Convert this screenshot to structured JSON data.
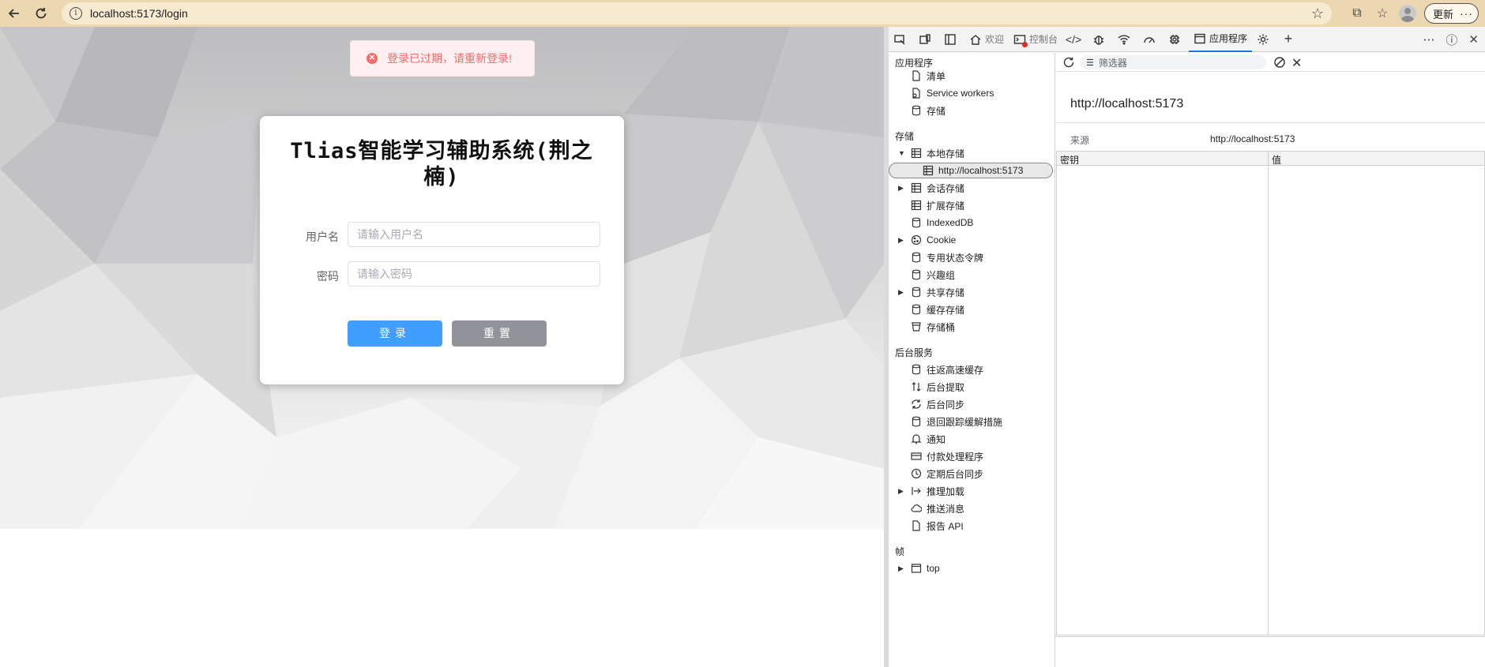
{
  "browser": {
    "url": "localhost:5173/login",
    "update_label": "更新",
    "more_label": "···"
  },
  "toast": {
    "message": "登录已过期，请重新登录!",
    "type": "error"
  },
  "login": {
    "title": "Tlias智能学习辅助系统(荆之楠)",
    "username_label": "用户名",
    "username_placeholder": "请输入用户名",
    "password_label": "密码",
    "password_placeholder": "请输入密码",
    "login_button": "登录",
    "reset_button": "重置"
  },
  "devtools": {
    "tabs": [
      {
        "label": "欢迎",
        "icon": "home-icon"
      },
      {
        "label": "控制台",
        "icon": "console-icon"
      },
      {
        "label": "应用程序",
        "icon": "application-icon",
        "active": true
      }
    ],
    "sidebar": {
      "section_app": "应用程序",
      "app_items": [
        "清单",
        "Service workers",
        "存储"
      ],
      "section_storage": "存储",
      "storage_items": [
        {
          "label": "本地存储",
          "expanded": true
        },
        {
          "label": "http://localhost:5173",
          "child": true,
          "selected": true
        },
        {
          "label": "会话存储",
          "collapsed": true
        },
        {
          "label": "扩展存储"
        },
        {
          "label": "IndexedDB"
        },
        {
          "label": "Cookie",
          "collapsed": true
        },
        {
          "label": "专用状态令牌"
        },
        {
          "label": "兴趣组"
        },
        {
          "label": "共享存储",
          "collapsed": true
        },
        {
          "label": "缓存存储"
        },
        {
          "label": "存储桶"
        }
      ],
      "section_bg": "后台服务",
      "bg_items": [
        "往返高速缓存",
        "后台提取",
        "后台同步",
        "退回跟踪缓解措施",
        "通知",
        "付款处理程序",
        "定期后台同步",
        "推理加载",
        "推送消息",
        "报告 API"
      ],
      "section_frames": "帧",
      "frame_items": [
        "top"
      ]
    },
    "main": {
      "filter_placeholder": "筛选器",
      "origin_title": "http://localhost:5173",
      "origin_key": "来源",
      "origin_value": "http://localhost:5173",
      "columns": [
        "密钥",
        "值"
      ]
    }
  },
  "colors": {
    "browser_chrome": "#ecd8b0",
    "primary_button": "#409eff",
    "info_button": "#909399",
    "error": "#f56c6c",
    "devtools_accent": "#1a73e8"
  }
}
